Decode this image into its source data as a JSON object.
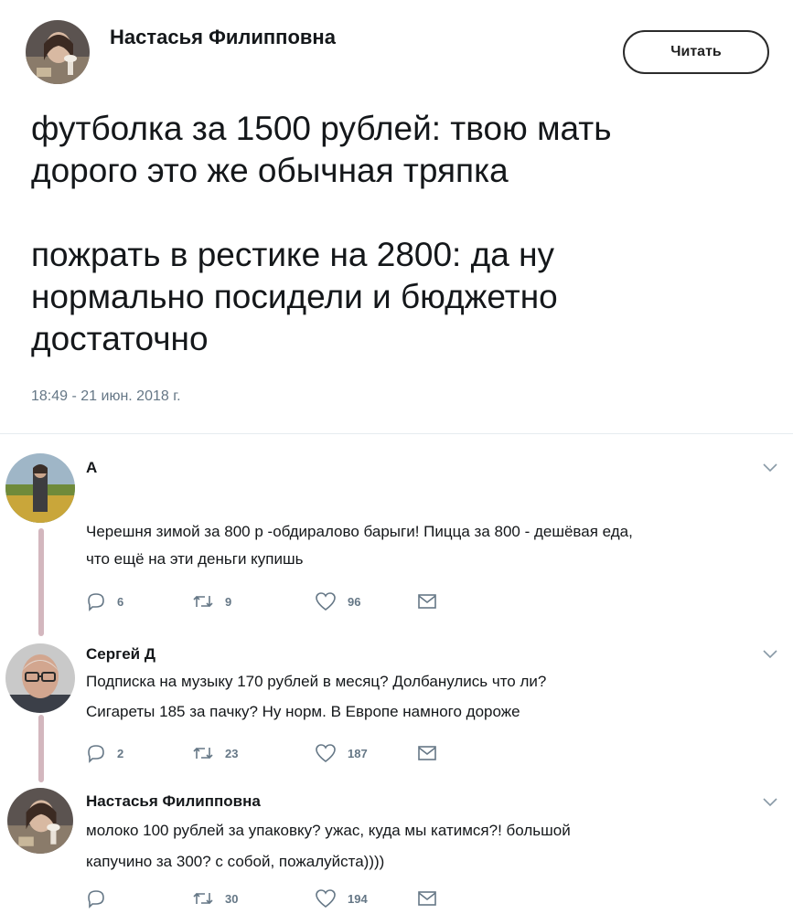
{
  "tweet": {
    "author": "Настасья Филипповна",
    "follow_label": "Читать",
    "text_line1": "футболка за 1500 рублей: твою мать",
    "text_line2": "дорого это же обычная тряпка",
    "text_line3": "пожрать в рестике на 2800: да ну",
    "text_line4": "нормально посидели и бюджетно",
    "text_line5": "достаточно",
    "timestamp": "18:49 - 21 июн. 2018 г."
  },
  "replies": [
    {
      "author": "А",
      "line1": "Черешня зимой за 800 р -обдиралово барыги! Пицца за 800 - дешёвая еда,",
      "line2": "что ещё на эти деньги купишь",
      "replies_count": "6",
      "retweets_count": "9",
      "likes_count": "96"
    },
    {
      "author": "Сергей Д",
      "line1": "Подписка на музыку 170 рублей в месяц? Долбанулись что ли?",
      "line2": "Сигареты 185 за пачку? Ну норм. В Европе намного дороже",
      "replies_count": "2",
      "retweets_count": "23",
      "likes_count": "187"
    },
    {
      "author": "Настасья Филипповна",
      "line1": "молоко 100 рублей за упаковку? ужас, куда мы катимся?! большой",
      "line2": "капучино за 300? с собой, пожалуйста))))",
      "replies_count": "",
      "retweets_count": "30",
      "likes_count": "194"
    }
  ],
  "icons": {
    "reply": "reply-icon",
    "retweet": "retweet-icon",
    "like": "heart-icon",
    "dm": "direct-message-icon",
    "menu": "chevron-down-icon"
  },
  "colors": {
    "thread_line": "#d3b7be",
    "meta_text": "#657786"
  }
}
